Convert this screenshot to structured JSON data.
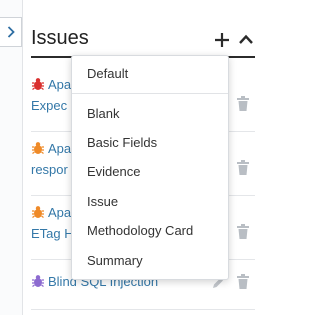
{
  "panel": {
    "title": "Issues",
    "add_icon": "plus-icon",
    "collapse_icon": "chevron-up-icon",
    "expand_icon": "chevron-right-icon"
  },
  "issues": [
    {
      "icon": "bug-icon",
      "severity_color": "#d9302f",
      "line1": "Apa",
      "line2": "Expec"
    },
    {
      "icon": "bug-icon",
      "severity_color": "#ef8a28",
      "line1": "Apa",
      "line2": "respor"
    },
    {
      "icon": "bug-icon",
      "severity_color": "#ef8a28",
      "line1": "Apa",
      "line2": "ETag H"
    },
    {
      "icon": "bug-icon",
      "severity_color": "#8d6bd0",
      "line1": "Blind SQL Injection",
      "line2": ""
    }
  ],
  "menu": {
    "items": [
      {
        "label": "Default"
      },
      {
        "label": "Blank"
      },
      {
        "label": "Basic Fields"
      },
      {
        "label": "Evidence"
      },
      {
        "label": "Issue"
      },
      {
        "label": "Methodology Card"
      },
      {
        "label": "Summary"
      }
    ]
  }
}
